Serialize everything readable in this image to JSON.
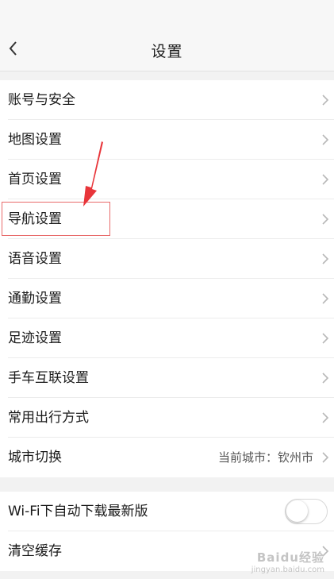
{
  "header": {
    "title": "设置",
    "back_icon": "chevron-left-icon"
  },
  "group1": {
    "items": [
      {
        "label": "账号与安全"
      },
      {
        "label": "地图设置"
      },
      {
        "label": "首页设置"
      },
      {
        "label": "导航设置"
      },
      {
        "label": "语音设置"
      },
      {
        "label": "通勤设置"
      },
      {
        "label": "足迹设置"
      },
      {
        "label": "手车互联设置"
      },
      {
        "label": "常用出行方式"
      },
      {
        "label": "城市切换",
        "value": "当前城市：钦州市"
      }
    ]
  },
  "group2": {
    "items": [
      {
        "label": "Wi-Fi下自动下载最新版",
        "toggle_on": false
      },
      {
        "label": "清空缓存"
      }
    ]
  },
  "annotation": {
    "highlight_color": "#e86a6a",
    "arrow_color": "#e8353a"
  },
  "watermark": {
    "line1": "Baidu经验",
    "line2": "jingyan.baidu.com"
  }
}
